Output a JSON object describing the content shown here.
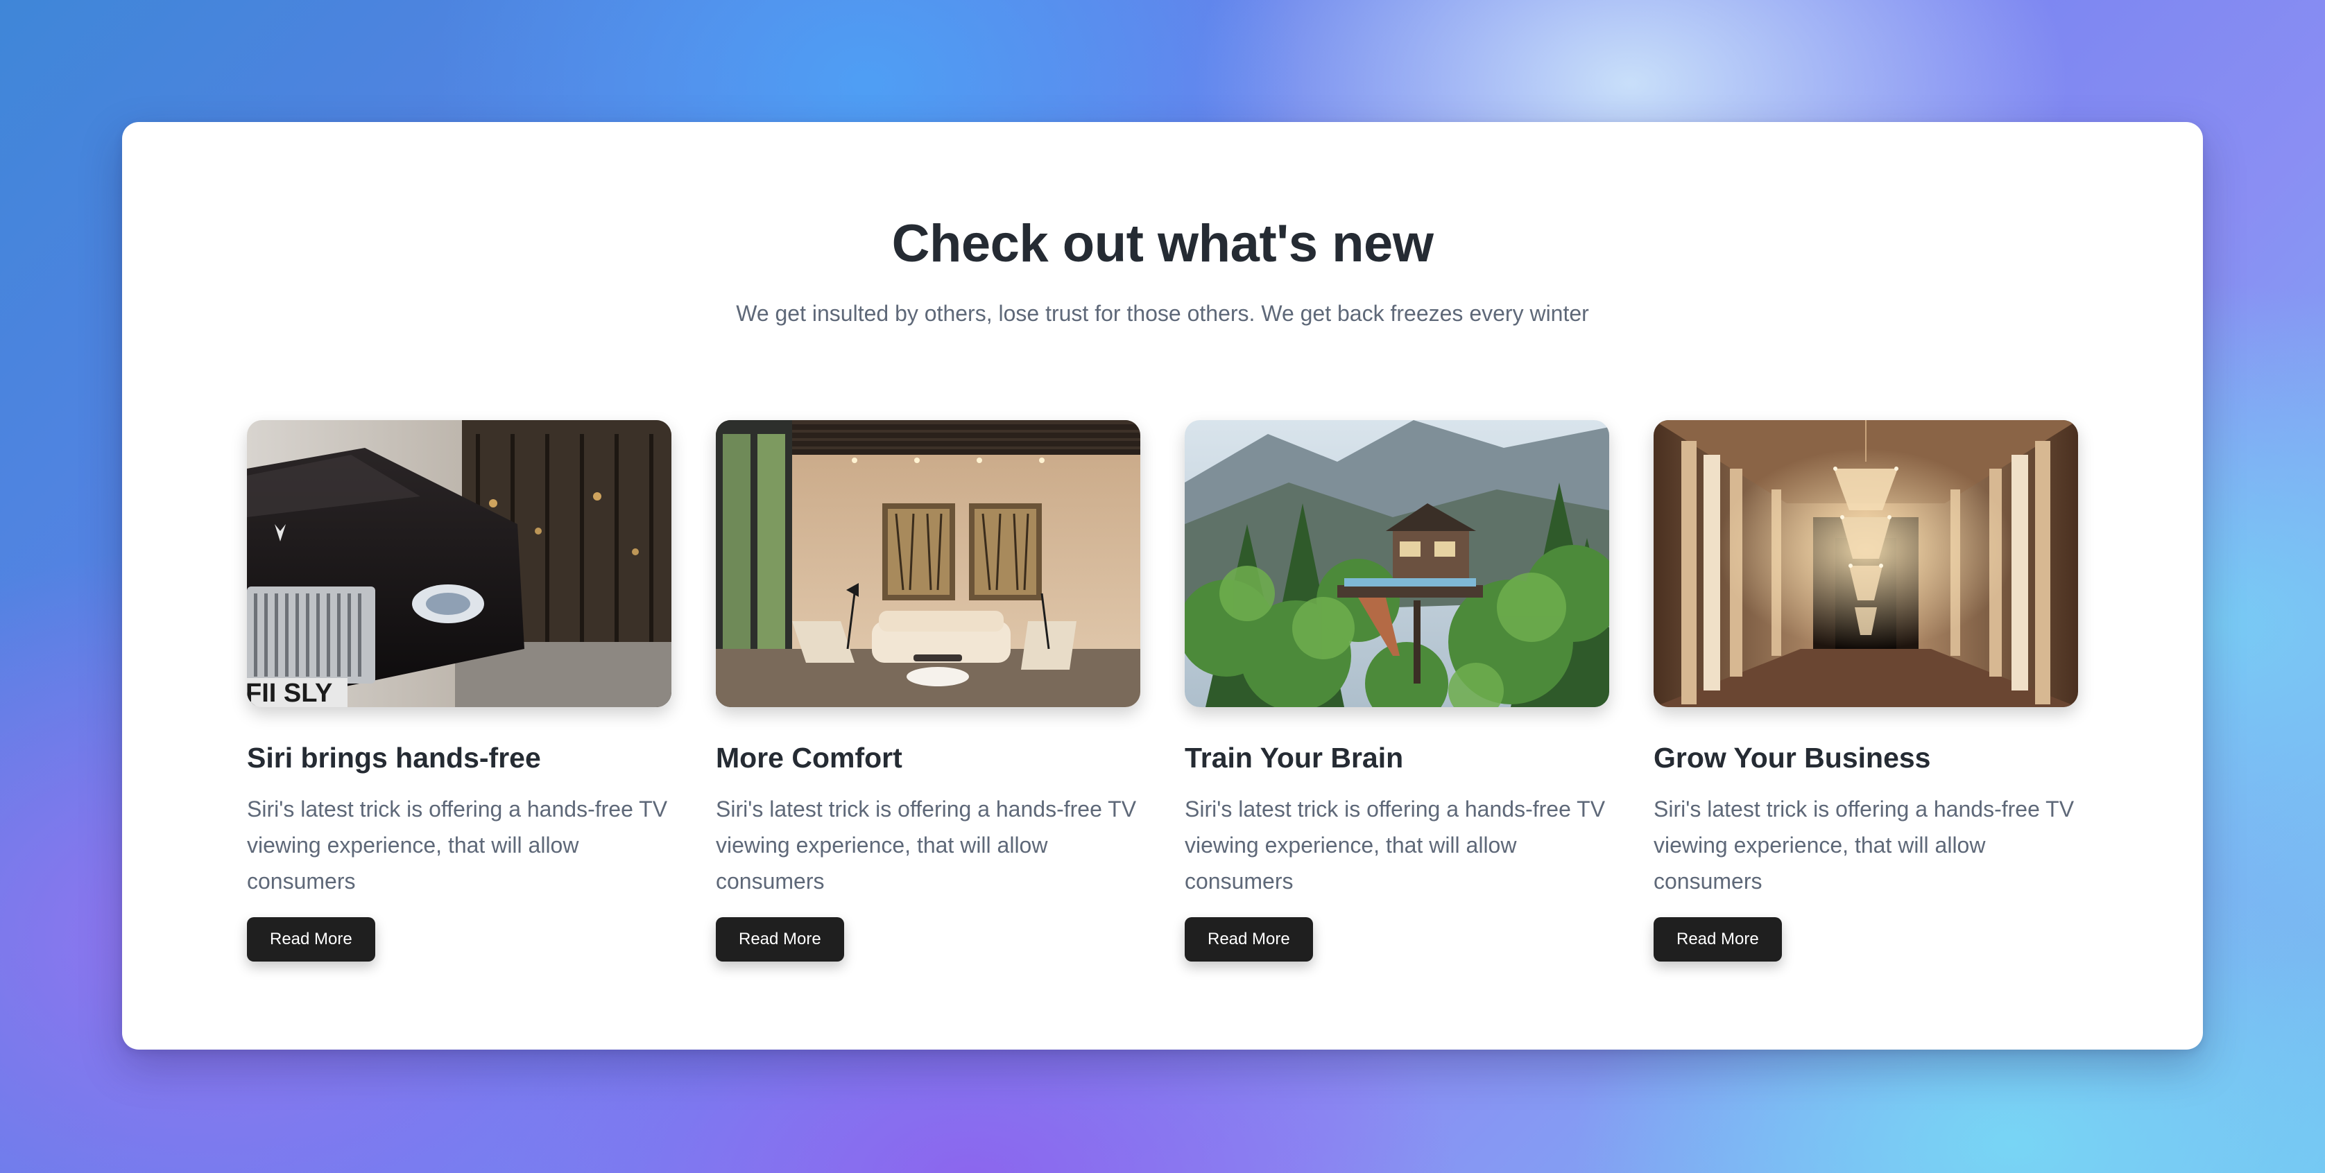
{
  "section": {
    "title": "Check out what's new",
    "subtitle": "We get insulted by others, lose trust for those others. We get back freezes every winter"
  },
  "cards": [
    {
      "image": "luxury-car-photo",
      "title": "Siri brings hands-free",
      "text": "Siri's latest trick is offering a hands-free TV viewing experience, that will allow consumers",
      "button": "Read More"
    },
    {
      "image": "lounge-interior-photo",
      "title": "More Comfort",
      "text": "Siri's latest trick is offering a hands-free TV viewing experience, that will allow consumers",
      "button": "Read More"
    },
    {
      "image": "forest-treehouse-photo",
      "title": "Train Your Brain",
      "text": "Siri's latest trick is offering a hands-free TV viewing experience, that will allow consumers",
      "button": "Read More"
    },
    {
      "image": "chandelier-hallway-photo",
      "title": "Grow Your Business",
      "text": "Siri's latest trick is offering a hands-free TV viewing experience, that will allow consumers",
      "button": "Read More"
    }
  ],
  "car_plate": "FII SLY",
  "colors": {
    "card_background": "#ffffff",
    "heading": "#252b33",
    "body_text": "#5e6878",
    "button_background": "#1f1f1f",
    "button_text": "#ffffff"
  }
}
